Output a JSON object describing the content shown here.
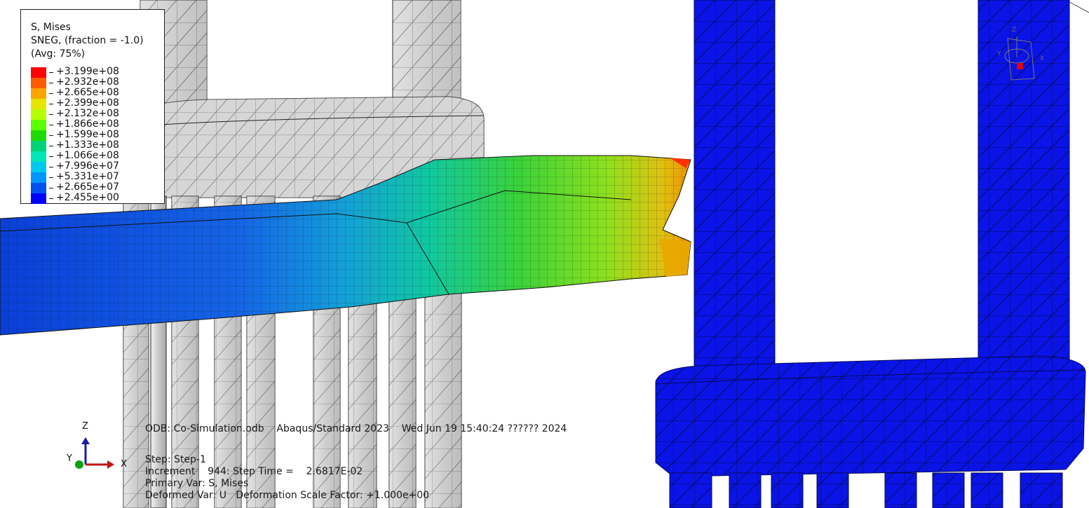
{
  "legend": {
    "title_line1": "S, Mises",
    "title_line2": "SNEG, (fraction = -1.0)",
    "title_line3": "(Avg: 75%)",
    "entries": [
      {
        "label": "+3.199e+08",
        "color": "#ff0000"
      },
      {
        "label": "+2.932e+08",
        "color": "#ff5a00"
      },
      {
        "label": "+2.665e+08",
        "color": "#ffa500"
      },
      {
        "label": "+2.399e+08",
        "color": "#e6e600"
      },
      {
        "label": "+2.132e+08",
        "color": "#b4ff00"
      },
      {
        "label": "+1.866e+08",
        "color": "#5aff00"
      },
      {
        "label": "+1.599e+08",
        "color": "#1edc00"
      },
      {
        "label": "+1.333e+08",
        "color": "#00d278"
      },
      {
        "label": "+1.066e+08",
        "color": "#00e6b4"
      },
      {
        "label": "+7.996e+07",
        "color": "#00c8f0"
      },
      {
        "label": "+5.331e+07",
        "color": "#0096ff"
      },
      {
        "label": "+2.665e+07",
        "color": "#0050f0"
      },
      {
        "label": "+2.455e+00",
        "color": "#0000ff"
      }
    ]
  },
  "info": {
    "line1": "ODB: Co-Simulation.odb    Abaqus/Standard 2023    Wed Jun 19 15:40:24 ?????? 2024",
    "line2": "Step: Step-1",
    "line3": "Increment    944: Step Time =    2.6817E-02",
    "line4": "Primary Var: S, Mises",
    "line5": "Deformed Var: U   Deformation Scale Factor: +1.000e+00"
  },
  "triad": {
    "z": "Z",
    "y": "Y",
    "x": "X"
  },
  "view_cube": {
    "z": "Z",
    "y": "Y",
    "x": "X"
  },
  "colors": {
    "pier_gray": "#cfcfcf",
    "pier_blue": "#0a14e6",
    "mesh_line": "#1a1a1a"
  }
}
